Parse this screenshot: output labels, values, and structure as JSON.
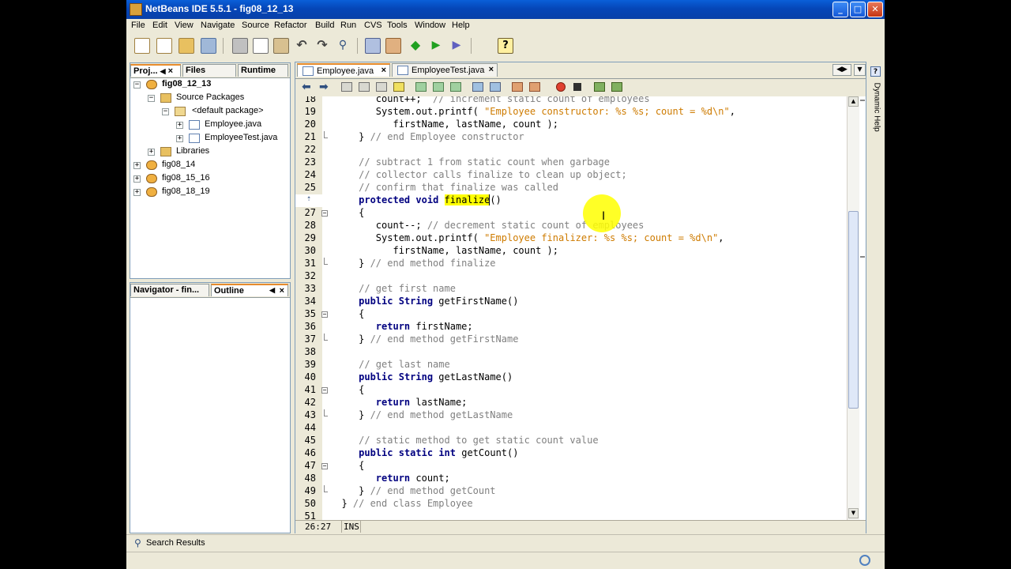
{
  "window": {
    "title": "NetBeans IDE 5.5.1 - fig08_12_13"
  },
  "menu": [
    "File",
    "Edit",
    "View",
    "Navigate",
    "Source",
    "Refactor",
    "Build",
    "Run",
    "CVS",
    "Tools",
    "Window",
    "Help"
  ],
  "project_panel": {
    "tabs": [
      "Proj...",
      "Files",
      "Runtime"
    ],
    "tree": [
      {
        "label": "fig08_12_13"
      },
      {
        "label": "Source Packages"
      },
      {
        "label": "<default package>"
      },
      {
        "label": "Employee.java"
      },
      {
        "label": "EmployeeTest.java"
      },
      {
        "label": "Libraries"
      },
      {
        "label": "fig08_14"
      },
      {
        "label": "fig08_15_16"
      },
      {
        "label": "fig08_18_19"
      }
    ]
  },
  "navigator_panel": {
    "tabs": [
      "Navigator - fin...",
      "Outline"
    ]
  },
  "editor": {
    "tabs": [
      "Employee.java",
      "EmployeeTest.java"
    ],
    "status": {
      "position": "26:27",
      "mode": "INS"
    }
  },
  "bottom_panel": {
    "search_results": "Search Results"
  },
  "code_lines": [
    {
      "n": "18",
      "t": "        count++;  // increment static count of employees"
    },
    {
      "n": "19",
      "t": "        System.out.printf( \"Employee constructor: %s %s; count = %d\\n\","
    },
    {
      "n": "20",
      "t": "           firstName, lastName, count );"
    },
    {
      "n": "21",
      "t": "     } // end Employee constructor"
    },
    {
      "n": "22",
      "t": ""
    },
    {
      "n": "23",
      "t": "     // subtract 1 from static count when garbage"
    },
    {
      "n": "24",
      "t": "     // collector calls finalize to clean up object;"
    },
    {
      "n": "25",
      "t": "     // confirm that finalize was called"
    },
    {
      "n": "",
      "t": "     protected void finalize()"
    },
    {
      "n": "27",
      "t": "     {"
    },
    {
      "n": "28",
      "t": "        count--; // decrement static count of employees"
    },
    {
      "n": "29",
      "t": "        System.out.printf( \"Employee finalizer: %s %s; count = %d\\n\","
    },
    {
      "n": "30",
      "t": "           firstName, lastName, count );"
    },
    {
      "n": "31",
      "t": "     } // end method finalize"
    },
    {
      "n": "32",
      "t": ""
    },
    {
      "n": "33",
      "t": "     // get first name"
    },
    {
      "n": "34",
      "t": "     public String getFirstName()"
    },
    {
      "n": "35",
      "t": "     {"
    },
    {
      "n": "36",
      "t": "        return firstName;"
    },
    {
      "n": "37",
      "t": "     } // end method getFirstName"
    },
    {
      "n": "38",
      "t": ""
    },
    {
      "n": "39",
      "t": "     // get last name"
    },
    {
      "n": "40",
      "t": "     public String getLastName()"
    },
    {
      "n": "41",
      "t": "     {"
    },
    {
      "n": "42",
      "t": "        return lastName;"
    },
    {
      "n": "43",
      "t": "     } // end method getLastName"
    },
    {
      "n": "44",
      "t": ""
    },
    {
      "n": "45",
      "t": "     // static method to get static count value"
    },
    {
      "n": "46",
      "t": "     public static int getCount()"
    },
    {
      "n": "47",
      "t": "     {"
    },
    {
      "n": "48",
      "t": "        return count;"
    },
    {
      "n": "49",
      "t": "     } // end method getCount"
    },
    {
      "n": "50",
      "t": "  } // end class Employee"
    },
    {
      "n": "51",
      "t": ""
    }
  ]
}
